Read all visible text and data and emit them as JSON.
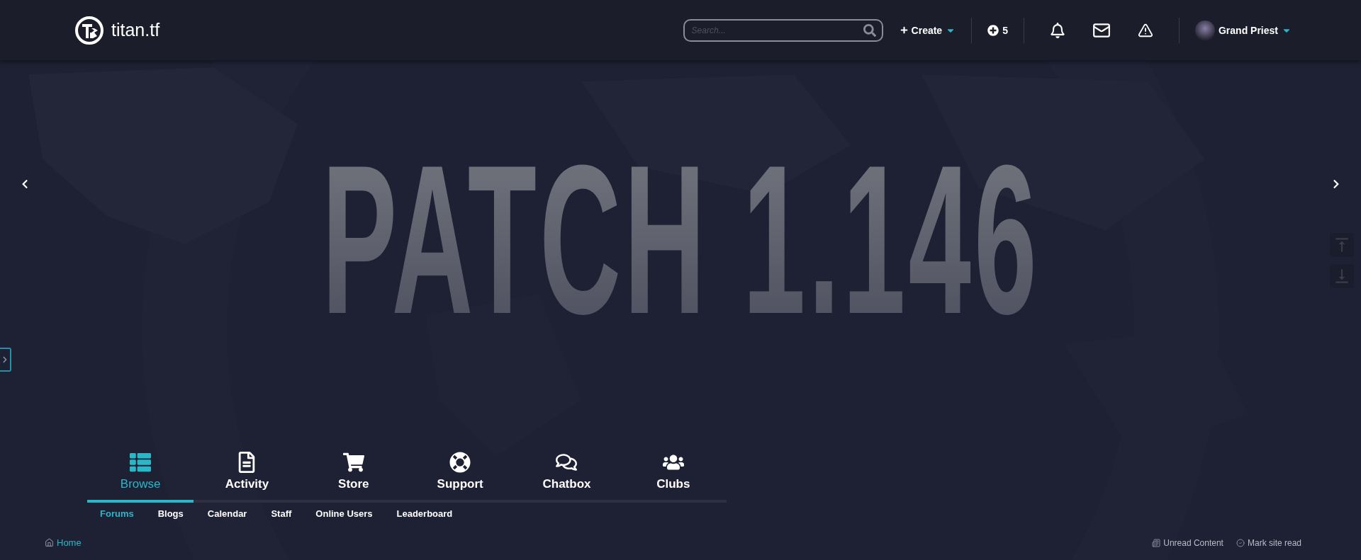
{
  "header": {
    "logo": "titan.tf",
    "search": {
      "placeholder": "Search..."
    },
    "create": "Create",
    "points": "5",
    "user": "Grand Priest"
  },
  "hero": {
    "title": "PATCH 1.146"
  },
  "tabs": [
    {
      "label": "Browse",
      "selected": true
    },
    {
      "label": "Activity",
      "selected": false
    },
    {
      "label": "Store",
      "selected": false
    },
    {
      "label": "Support",
      "selected": false
    },
    {
      "label": "Chatbox",
      "selected": false
    },
    {
      "label": "Clubs",
      "selected": false
    }
  ],
  "subtabs": [
    {
      "label": "Forums",
      "selected": true
    },
    {
      "label": "Blogs",
      "selected": false
    },
    {
      "label": "Calendar",
      "selected": false
    },
    {
      "label": "Staff",
      "selected": false
    },
    {
      "label": "Online Users",
      "selected": false
    },
    {
      "label": "Leaderboard",
      "selected": false
    }
  ],
  "breadcrumb": {
    "home": "Home"
  },
  "actions": {
    "unread": "Unread Content",
    "mark_read": "Mark site read"
  }
}
